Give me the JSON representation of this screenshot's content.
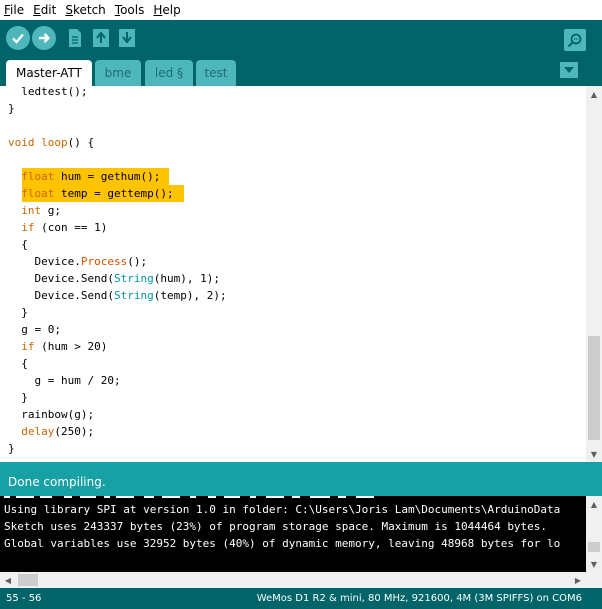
{
  "menu": {
    "items": [
      {
        "first": "F",
        "rest": "ile"
      },
      {
        "first": "E",
        "rest": "dit"
      },
      {
        "first": "S",
        "rest": "ketch"
      },
      {
        "first": "T",
        "rest": "ools"
      },
      {
        "first": "H",
        "rest": "elp"
      }
    ]
  },
  "toolbar": {
    "icons": [
      "verify-icon",
      "upload-icon",
      "new-icon",
      "open-icon",
      "save-icon",
      "serial-monitor-icon"
    ]
  },
  "tabs": [
    {
      "label": "Master-ATT",
      "active": true
    },
    {
      "label": "bme",
      "active": false
    },
    {
      "label": "led §",
      "active": false
    },
    {
      "label": "test",
      "active": false
    }
  ],
  "editor": {
    "lines": [
      [
        {
          "t": "  ledtest();",
          "c": ""
        }
      ],
      [
        {
          "t": "}",
          "c": ""
        }
      ],
      [
        {
          "t": "",
          "c": ""
        }
      ],
      [
        {
          "t": "void",
          "c": "kw"
        },
        {
          "t": " ",
          "c": ""
        },
        {
          "t": "loop",
          "c": "kw"
        },
        {
          "t": "() {",
          "c": ""
        }
      ],
      [
        {
          "t": "",
          "c": ""
        }
      ],
      [
        {
          "t": "  ",
          "c": ""
        },
        {
          "t": "float",
          "c": "kw"
        },
        {
          "t": " hum = gethum();",
          "c": ""
        }
      ],
      [
        {
          "t": "  ",
          "c": ""
        },
        {
          "t": "float",
          "c": "kw"
        },
        {
          "t": " temp = gettemp();",
          "c": ""
        }
      ],
      [
        {
          "t": "  ",
          "c": ""
        },
        {
          "t": "int",
          "c": "kw"
        },
        {
          "t": " g;",
          "c": ""
        }
      ],
      [
        {
          "t": "  ",
          "c": ""
        },
        {
          "t": "if",
          "c": "kw"
        },
        {
          "t": " (con == 1)",
          "c": ""
        }
      ],
      [
        {
          "t": "  {",
          "c": ""
        }
      ],
      [
        {
          "t": "    Device.",
          "c": ""
        },
        {
          "t": "Process",
          "c": "fn"
        },
        {
          "t": "();",
          "c": ""
        }
      ],
      [
        {
          "t": "    Device.Send(",
          "c": ""
        },
        {
          "t": "String",
          "c": "cls"
        },
        {
          "t": "(hum), 1);",
          "c": ""
        }
      ],
      [
        {
          "t": "    Device.Send(",
          "c": ""
        },
        {
          "t": "String",
          "c": "cls"
        },
        {
          "t": "(temp), 2);",
          "c": ""
        }
      ],
      [
        {
          "t": "  }",
          "c": ""
        }
      ],
      [
        {
          "t": "  g = 0;",
          "c": ""
        }
      ],
      [
        {
          "t": "  ",
          "c": ""
        },
        {
          "t": "if",
          "c": "kw"
        },
        {
          "t": " (hum > 20)",
          "c": ""
        }
      ],
      [
        {
          "t": "  {",
          "c": ""
        }
      ],
      [
        {
          "t": "    g = hum / 20;",
          "c": ""
        }
      ],
      [
        {
          "t": "  }",
          "c": ""
        }
      ],
      [
        {
          "t": "  rainbow(g);",
          "c": ""
        }
      ],
      [
        {
          "t": "  ",
          "c": ""
        },
        {
          "t": "delay",
          "c": "kw"
        },
        {
          "t": "(250);",
          "c": ""
        }
      ],
      [
        {
          "t": "}",
          "c": ""
        }
      ]
    ]
  },
  "status": {
    "message": "Done compiling."
  },
  "console": {
    "lines": [
      "Using library SPI at version 1.0 in folder: C:\\Users\\Joris Lam\\Documents\\ArduinoData",
      "Sketch uses 243337 bytes (23%) of program storage space. Maximum is 1044464 bytes.",
      "Global variables use 32952 bytes (40%) of dynamic memory, leaving 48968 bytes for lo"
    ]
  },
  "footer": {
    "cursor_position": "55 - 56",
    "board_info": "WeMos D1 R2 & mini, 80 MHz, 921600, 4M (3M SPIFFS) on COM6"
  },
  "colors": {
    "toolbar_bg": "#006468",
    "button_bg": "#4db7bb",
    "status_bg": "#17a1a5",
    "highlight": "#ffc300",
    "keyword": "#cc6600",
    "class": "#00979c"
  }
}
